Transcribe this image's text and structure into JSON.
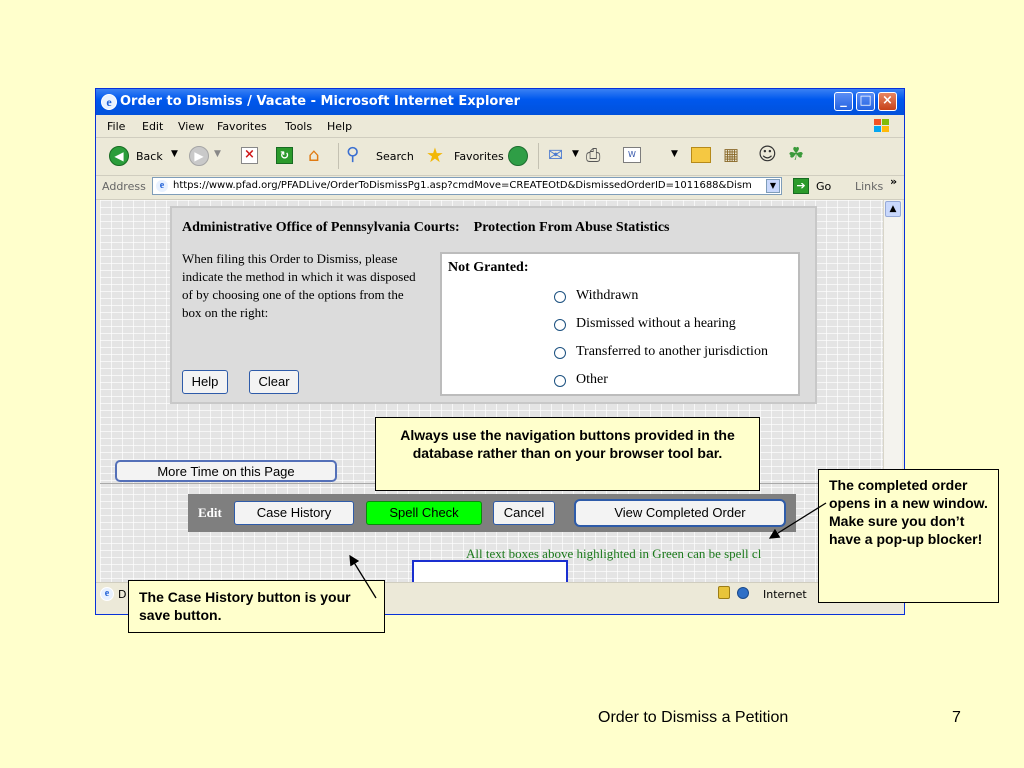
{
  "window": {
    "title": "Order to Dismiss / Vacate - Microsoft Internet Explorer"
  },
  "menu": [
    "File",
    "Edit",
    "View",
    "Favorites",
    "Tools",
    "Help"
  ],
  "toolbar": {
    "back_label": "Back",
    "search_label": "Search",
    "favorites_label": "Favorites"
  },
  "address": {
    "label": "Address",
    "url": "https://www.pfad.org/PFADLive/OrderToDismissPg1.asp?cmdMove=CREATEOtD&DismissedOrderID=1011688&Dism",
    "go_label": "Go",
    "links_label": "Links"
  },
  "page": {
    "header_left": "Administrative Office of Pennsylvania Courts:",
    "header_right": "Protection From Abuse Statistics",
    "instruction": "When filing this Order to Dismiss, please indicate the method in which it was disposed of by choosing one of the options from the box on the right:",
    "not_granted_label": "Not Granted:",
    "options": [
      "Withdrawn",
      "Dismissed without a hearing",
      "Transferred to another jurisdiction",
      "Other"
    ],
    "help_button": "Help",
    "clear_button": "Clear",
    "more_time_button": "More Time on this Page",
    "edit_label": "Edit",
    "case_history_button": "Case History",
    "spell_check_button": "Spell Check",
    "cancel_button": "Cancel",
    "view_completed_button": "View Completed Order",
    "spell_note": "All text boxes above highlighted in Green can be spell cl"
  },
  "status": {
    "left_text": "D",
    "zone": "Internet"
  },
  "callouts": {
    "navigation": "Always use the navigation buttons provided in the database rather than on your browser tool bar.",
    "completed": "The completed order opens in a new window. Make sure you don’t have a pop-up blocker!",
    "case_history": "The Case History button is your save button."
  },
  "footer": {
    "title": "Order to Dismiss a Petition",
    "page_number": "7"
  },
  "colors": {
    "slide_background": "#ffffcc",
    "titlebar_blue": "#0058ee",
    "spell_check_green": "#00ff00",
    "note_green": "#1c7a1c"
  }
}
